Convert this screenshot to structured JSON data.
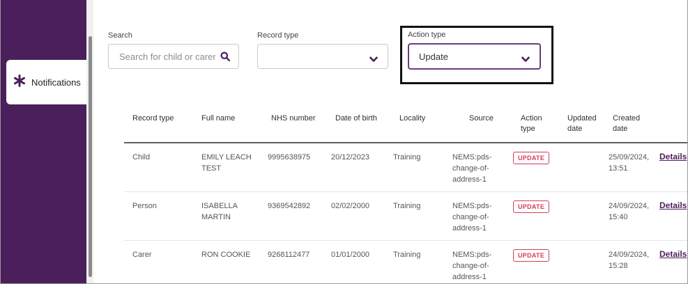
{
  "sidebar": {
    "notifications_label": "Notifications"
  },
  "filters": {
    "search_label": "Search",
    "search_placeholder": "Search for child or carer",
    "record_type_label": "Record type",
    "record_type_value": "",
    "action_type_label": "Action type",
    "action_type_value": "Update"
  },
  "table": {
    "headers": {
      "record_type": "Record type",
      "full_name": "Full name",
      "nhs_number": "NHS number",
      "date_of_birth": "Date of birth",
      "locality": "Locality",
      "source": "Source",
      "action_type_1": "Action",
      "action_type_2": "type",
      "updated_date_1": "Updated",
      "updated_date_2": "date",
      "created_date_1": "Created",
      "created_date_2": "date"
    },
    "rows": [
      {
        "record_type": "Child",
        "name_1": "EMILY LEACH",
        "name_2": "TEST",
        "nhs_number": "9995638975",
        "dob": "20/12/2023",
        "locality": "Training",
        "source_1": "NEMS:pds-",
        "source_2": "change-of-",
        "source_3": "address-1",
        "action": "UPDATE",
        "updated": "",
        "created_1": "25/09/2024,",
        "created_2": "13:51",
        "details": "Details"
      },
      {
        "record_type": "Person",
        "name_1": "ISABELLA",
        "name_2": "MARTIN",
        "nhs_number": "9369542892",
        "dob": "02/02/2000",
        "locality": "Training",
        "source_1": "NEMS:pds-",
        "source_2": "change-of-",
        "source_3": "address-1",
        "action": "UPDATE",
        "updated": "",
        "created_1": "24/09/2024,",
        "created_2": "15:40",
        "details": "Details"
      },
      {
        "record_type": "Carer",
        "name_1": "RON COOKIE",
        "name_2": "",
        "nhs_number": "9268112477",
        "dob": "01/01/2000",
        "locality": "Training",
        "source_1": "NEMS:pds-",
        "source_2": "change-of-",
        "source_3": "address-1",
        "action": "UPDATE",
        "updated": "",
        "created_1": "24/09/2024,",
        "created_2": "15:28",
        "details": "Details"
      }
    ]
  },
  "colors": {
    "brand_purple": "#4b1f5c",
    "badge_red": "#d23d5b"
  },
  "icons": {
    "nav": "asterisk-icon",
    "search": "search-icon",
    "dropdown": "chevron-down-icon"
  }
}
